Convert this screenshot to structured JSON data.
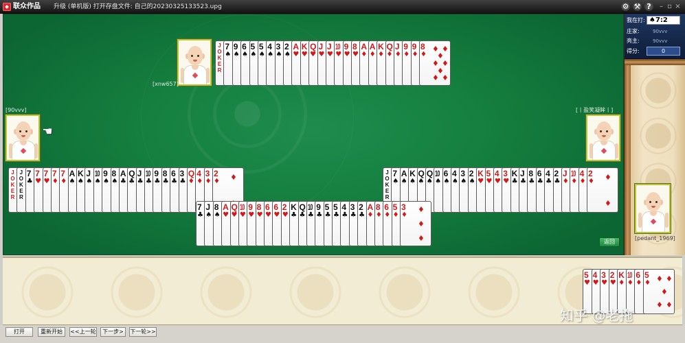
{
  "title_bar": {
    "logo_text": "联众作品",
    "title": "升级 (单机版) 打开存盘文件: 自己的20230325133523.upg",
    "icons": [
      {
        "name": "settings-icon",
        "glyph": "⚙"
      },
      {
        "name": "tools-icon",
        "glyph": "⚒"
      },
      {
        "name": "help-icon",
        "glyph": "?"
      },
      {
        "name": "minimize-icon",
        "glyph": "–"
      },
      {
        "name": "restore-icon",
        "glyph": "▫"
      },
      {
        "name": "close-icon",
        "glyph": "×"
      }
    ]
  },
  "players": {
    "top": {
      "name": "[xnw657]",
      "cards": [
        {
          "r": "JOKER",
          "c": "red"
        },
        {
          "r": "7",
          "s": "♠"
        },
        {
          "r": "9",
          "s": "♠"
        },
        {
          "r": "6",
          "s": "♠"
        },
        {
          "r": "5",
          "s": "♠"
        },
        {
          "r": "5",
          "s": "♠"
        },
        {
          "r": "4",
          "s": "♠"
        },
        {
          "r": "3",
          "s": "♠"
        },
        {
          "r": "2",
          "s": "♠"
        },
        {
          "r": "A",
          "s": "♥"
        },
        {
          "r": "K",
          "s": "♥"
        },
        {
          "r": "Q",
          "s": "♥"
        },
        {
          "r": "J",
          "s": "♥"
        },
        {
          "r": "J",
          "s": "♥"
        },
        {
          "r": "10",
          "s": "♥"
        },
        {
          "r": "9",
          "s": "♥"
        },
        {
          "r": "8",
          "s": "♥"
        },
        {
          "r": "A",
          "s": "♦"
        },
        {
          "r": "A",
          "s": "♦"
        },
        {
          "r": "K",
          "s": "♦"
        },
        {
          "r": "Q",
          "s": "♦"
        },
        {
          "r": "J",
          "s": "♦"
        },
        {
          "r": "9",
          "s": "♦"
        },
        {
          "r": "9",
          "s": "♦"
        },
        {
          "r": "8",
          "s": "♦"
        }
      ]
    },
    "left": {
      "name": "[90vvv]",
      "turn_icon": "☚",
      "cards": [
        {
          "r": "JOKER",
          "c": "red"
        },
        {
          "r": "JOKER",
          "c": "black"
        },
        {
          "r": "7",
          "s": "♣"
        },
        {
          "r": "7",
          "s": "♥"
        },
        {
          "r": "7",
          "s": "♥"
        },
        {
          "r": "7",
          "s": "♦"
        },
        {
          "r": "7",
          "s": "♦"
        },
        {
          "r": "A",
          "s": "♠"
        },
        {
          "r": "K",
          "s": "♠"
        },
        {
          "r": "J",
          "s": "♠"
        },
        {
          "r": "10",
          "s": "♠"
        },
        {
          "r": "9",
          "s": "♠"
        },
        {
          "r": "8",
          "s": "♠"
        },
        {
          "r": "A",
          "s": "♣"
        },
        {
          "r": "Q",
          "s": "♣"
        },
        {
          "r": "J",
          "s": "♣"
        },
        {
          "r": "10",
          "s": "♣"
        },
        {
          "r": "9",
          "s": "♣"
        },
        {
          "r": "8",
          "s": "♣"
        },
        {
          "r": "6",
          "s": "♣"
        },
        {
          "r": "3",
          "s": "♣"
        },
        {
          "r": "Q",
          "s": "♦"
        },
        {
          "r": "4",
          "s": "♦"
        },
        {
          "r": "3",
          "s": "♦"
        },
        {
          "r": "2",
          "s": "♦"
        }
      ]
    },
    "right": {
      "name": "[丨盈笑凝眸丨]",
      "cards": [
        {
          "r": "JOKER",
          "c": "black"
        },
        {
          "r": "7",
          "s": "♠"
        },
        {
          "r": "A",
          "s": "♠"
        },
        {
          "r": "K",
          "s": "♠"
        },
        {
          "r": "Q",
          "s": "♠"
        },
        {
          "r": "Q",
          "s": "♠"
        },
        {
          "r": "10",
          "s": "♠"
        },
        {
          "r": "6",
          "s": "♠"
        },
        {
          "r": "4",
          "s": "♠"
        },
        {
          "r": "3",
          "s": "♠"
        },
        {
          "r": "2",
          "s": "♠"
        },
        {
          "r": "K",
          "s": "♥"
        },
        {
          "r": "5",
          "s": "♥"
        },
        {
          "r": "4",
          "s": "♥"
        },
        {
          "r": "3",
          "s": "♥"
        },
        {
          "r": "K",
          "s": "♣"
        },
        {
          "r": "J",
          "s": "♣"
        },
        {
          "r": "8",
          "s": "♣"
        },
        {
          "r": "6",
          "s": "♣"
        },
        {
          "r": "4",
          "s": "♣"
        },
        {
          "r": "2",
          "s": "♣"
        },
        {
          "r": "J",
          "s": "♦"
        },
        {
          "r": "10",
          "s": "♦"
        },
        {
          "r": "4",
          "s": "♦"
        },
        {
          "r": "2",
          "s": "♦"
        }
      ]
    },
    "bottom": {
      "name": "[pedant_1969]",
      "cards": [
        {
          "r": "7",
          "s": "♣"
        },
        {
          "r": "J",
          "s": "♠"
        },
        {
          "r": "8",
          "s": "♠"
        },
        {
          "r": "A",
          "s": "♥"
        },
        {
          "r": "Q",
          "s": "♥"
        },
        {
          "r": "10",
          "s": "♥"
        },
        {
          "r": "9",
          "s": "♥"
        },
        {
          "r": "8",
          "s": "♥"
        },
        {
          "r": "6",
          "s": "♥"
        },
        {
          "r": "6",
          "s": "♥"
        },
        {
          "r": "2",
          "s": "♥"
        },
        {
          "r": "K",
          "s": "♣"
        },
        {
          "r": "Q",
          "s": "♣"
        },
        {
          "r": "10",
          "s": "♣"
        },
        {
          "r": "9",
          "s": "♣"
        },
        {
          "r": "5",
          "s": "♣"
        },
        {
          "r": "5",
          "s": "♣"
        },
        {
          "r": "4",
          "s": "♣"
        },
        {
          "r": "3",
          "s": "♣"
        },
        {
          "r": "2",
          "s": "♣"
        },
        {
          "r": "A",
          "s": "♦"
        },
        {
          "r": "8",
          "s": "♦"
        },
        {
          "r": "6",
          "s": "♦"
        },
        {
          "r": "5",
          "s": "♦"
        },
        {
          "r": "3",
          "s": "♦"
        }
      ]
    }
  },
  "kitty": {
    "cards": [
      {
        "r": "5",
        "s": "♥"
      },
      {
        "r": "4",
        "s": "♥"
      },
      {
        "r": "3",
        "s": "♥"
      },
      {
        "r": "2",
        "s": "♥"
      },
      {
        "r": "K",
        "s": "♦"
      },
      {
        "r": "10",
        "s": "♦"
      },
      {
        "r": "6",
        "s": "♦"
      },
      {
        "r": "5",
        "s": "♦"
      }
    ]
  },
  "status": {
    "playing_label": "我在打:",
    "playing_value": "♠7:2",
    "dealer_label": "庄家:",
    "dealer_value": "90vvv",
    "trump_label": "亮主:",
    "trump_value": "90vvv",
    "score_label": "得分:",
    "score_value": "0"
  },
  "return_button": "返回",
  "controls": {
    "open": "打开",
    "restart": "重新开始",
    "prev_round": "<<上一轮",
    "next_step": "下一步>",
    "next_round": "下一轮>>"
  },
  "watermark": "知乎 @老拖",
  "colors": {
    "felt": "#15803f",
    "red_suit": "#d31818",
    "black_suit": "#111111",
    "avatar_border": "#b8c63c",
    "panel_navy": "#1f3760"
  }
}
